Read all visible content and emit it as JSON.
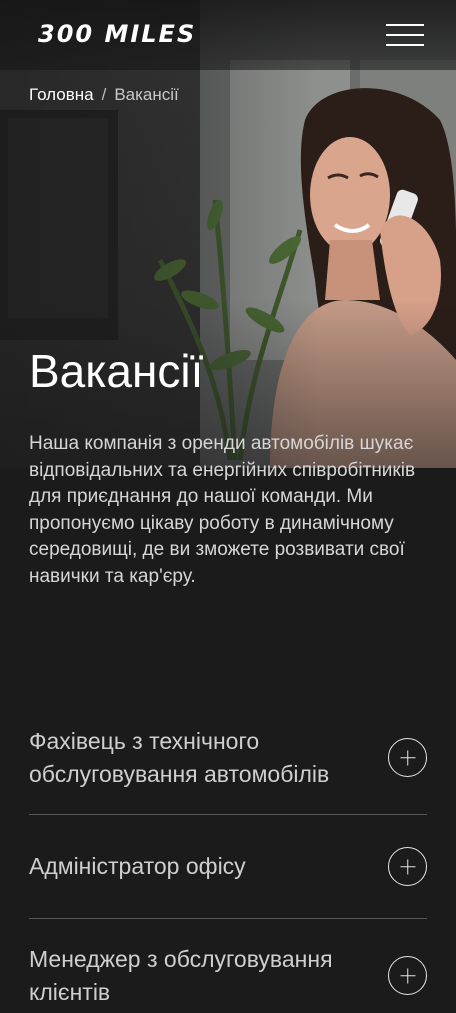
{
  "header": {
    "logo_text": "300 MILES",
    "menu_icon": "hamburger-menu-icon"
  },
  "breadcrumb": {
    "home": "Головна",
    "separator": "/",
    "current": "Вакансії"
  },
  "hero": {
    "image_alt": "Жінка розмовляє по телефону в офісі"
  },
  "main": {
    "title": "Вакансії",
    "intro": "Наша компанія з оренди автомобілів шукає відповідальних та енергійних співробітників для приєднання до нашої команди. Ми пропонуємо цікаву роботу в динамічному середовищі, де ви зможете розвивати свої навички та кар'єру."
  },
  "vacancies": [
    {
      "title": "Фахівець з технічного обслуговування автомобілів",
      "expand_icon": "plus-circle-icon"
    },
    {
      "title": "Адміністратор офісу",
      "expand_icon": "plus-circle-icon"
    },
    {
      "title": "Менеджер з обслуговування клієнтів",
      "expand_icon": "plus-circle-icon"
    }
  ],
  "colors": {
    "background": "#1b1b1b",
    "text": "#ffffff",
    "muted_text": "#cfcfcf",
    "divider": "#575757"
  }
}
